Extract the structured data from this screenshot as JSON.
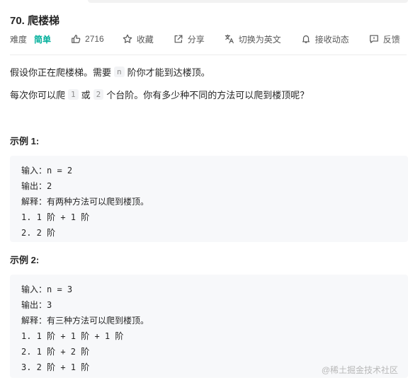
{
  "problem": {
    "title": "70. 爬楼梯"
  },
  "meta": {
    "difficulty_label": "难度",
    "difficulty_value": "简单",
    "likes": "2716",
    "favorite_label": "收藏",
    "share_label": "分享",
    "switch_lang_label": "切换为英文",
    "notify_label": "接收动态",
    "feedback_label": "反馈",
    "difficulty_color": "#00af9b"
  },
  "description": {
    "p1_before": "假设你正在爬楼梯。需要",
    "p1_code": "n",
    "p1_after": "阶你才能到达楼顶。",
    "p2_before": "每次你可以爬",
    "p2_code1": "1",
    "p2_mid": "或",
    "p2_code2": "2",
    "p2_after": "个台阶。你有多少种不同的方法可以爬到楼顶呢？"
  },
  "examples": [
    {
      "title": "示例 1:",
      "lines": [
        "输入：n = 2",
        "输出：2",
        "解释：有两种方法可以爬到楼顶。",
        "1. 1 阶 + 1 阶",
        "2. 2 阶"
      ]
    },
    {
      "title": "示例 2:",
      "lines": [
        "输入：n = 3",
        "输出：3",
        "解释：有三种方法可以爬到楼顶。",
        "1. 1 阶 + 1 阶 + 1 阶",
        "2. 1 阶 + 2 阶",
        "3. 2 阶 + 1 阶"
      ]
    }
  ],
  "watermark": "@稀土掘金技术社区",
  "icons": {
    "like": "thumbs-up-icon",
    "favorite": "star-icon",
    "share": "share-icon",
    "language": "translate-icon",
    "notify": "bell-icon",
    "feedback": "message-icon"
  }
}
